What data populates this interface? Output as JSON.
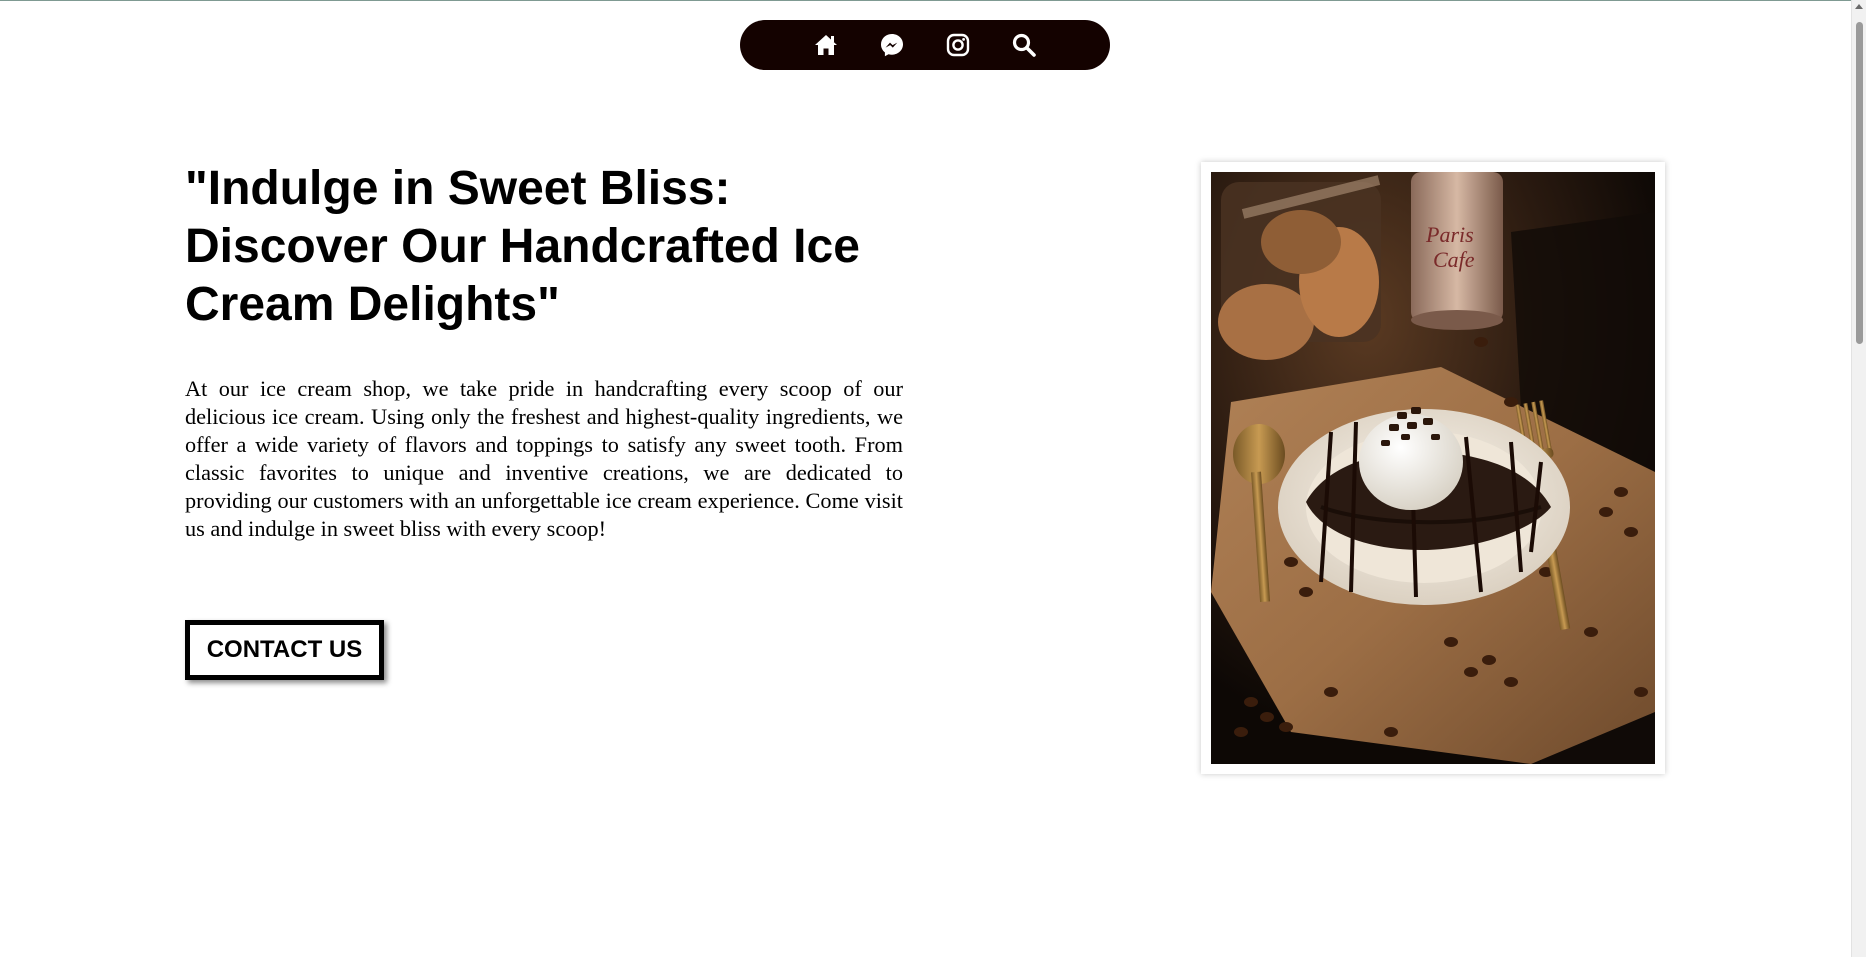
{
  "nav": {
    "items": [
      {
        "icon": "home-icon"
      },
      {
        "icon": "messenger-icon"
      },
      {
        "icon": "instagram-icon"
      },
      {
        "icon": "search-icon"
      }
    ],
    "background": "#140200",
    "icon_color": "#ffffff"
  },
  "hero": {
    "title": "\"Indulge in Sweet Bliss: Discover Our Handcrafted Ice Cream Delights\"",
    "body": "At our ice cream shop, we take pride in handcrafting every scoop of our delicious ice cream. Using only the freshest and highest-quality ingredients, we offer a wide variety of flavors and toppings to satisfy any sweet tooth. From classic favorites to unique and inventive creations, we are dedicated to providing our customers with an unforgettable ice cream experience. Come visit us and indulge in sweet bliss with every scoop!",
    "cta_label": "CONTACT US"
  },
  "photo": {
    "subject": "ice-cream-on-chocolate-waffle"
  }
}
